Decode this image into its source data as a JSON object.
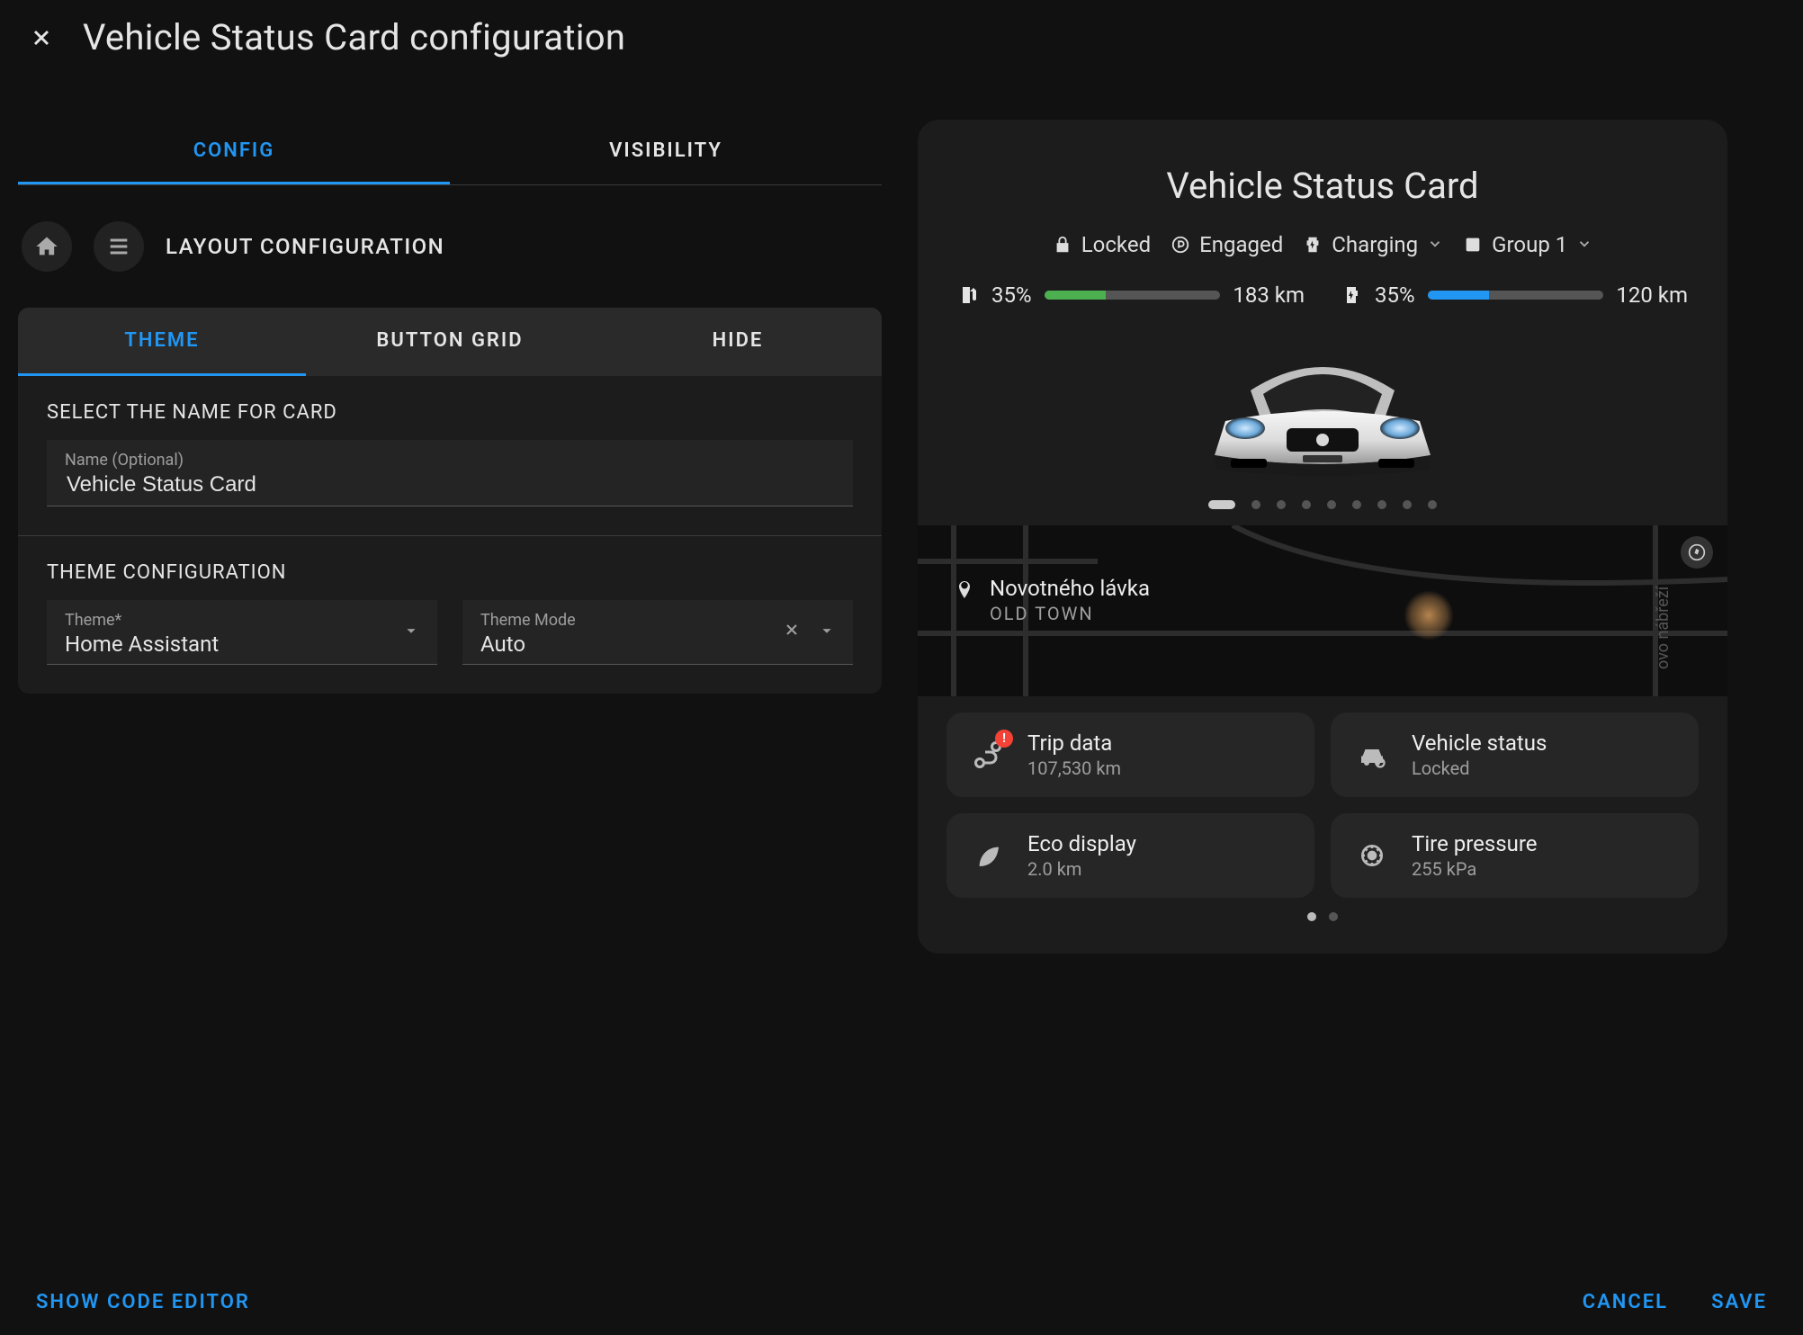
{
  "header": {
    "title": "Vehicle Status Card configuration"
  },
  "tabs": {
    "config": "CONFIG",
    "visibility": "VISIBILITY"
  },
  "breadcrumb": {
    "title": "LAYOUT CONFIGURATION"
  },
  "inner_tabs": {
    "theme": "THEME",
    "button_grid": "BUTTON GRID",
    "hide": "HIDE"
  },
  "sections": {
    "name_label": "SELECT THE NAME FOR CARD",
    "theme_label": "THEME CONFIGURATION"
  },
  "fields": {
    "name": {
      "label": "Name (Optional)",
      "value": "Vehicle Status Card"
    },
    "theme": {
      "label": "Theme*",
      "value": "Home Assistant"
    },
    "theme_mode": {
      "label": "Theme Mode",
      "value": "Auto"
    }
  },
  "preview": {
    "title": "Vehicle Status Card",
    "status": {
      "locked": "Locked",
      "engaged": "Engaged",
      "charging": "Charging",
      "group": "Group 1"
    },
    "range1": {
      "pct": "35%",
      "km": "183 km"
    },
    "range2": {
      "pct": "35%",
      "km": "120 km"
    },
    "location": {
      "name": "Novotného lávka",
      "sub": "OLD TOWN",
      "street": "ovo nábřeží"
    },
    "cards": {
      "trip": {
        "title": "Trip data",
        "value": "107,530 km",
        "alert": "!"
      },
      "status": {
        "title": "Vehicle status",
        "value": "Locked"
      },
      "eco": {
        "title": "Eco display",
        "value": "2.0 km"
      },
      "tire": {
        "title": "Tire pressure",
        "value": "255 kPa"
      }
    }
  },
  "footer": {
    "code_editor": "SHOW CODE EDITOR",
    "cancel": "CANCEL",
    "save": "SAVE"
  }
}
